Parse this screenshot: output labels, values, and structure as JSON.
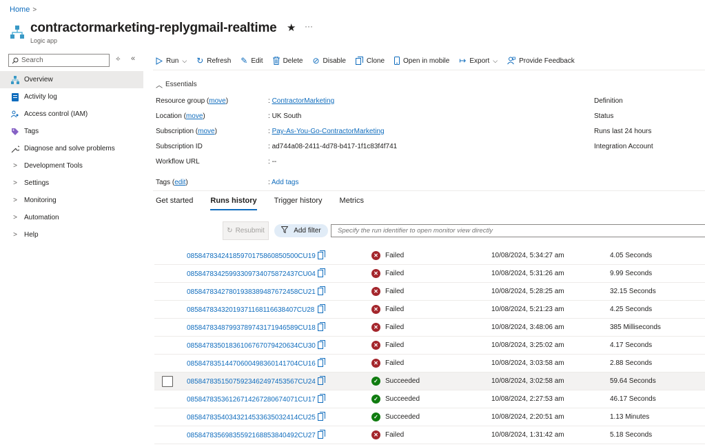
{
  "breadcrumb": {
    "home": "Home"
  },
  "header": {
    "title": "contractormarketing-replygmail-realtime",
    "subtitle": "Logic app",
    "star": "★",
    "more": "···"
  },
  "sidebar": {
    "search_placeholder": "Search",
    "items": [
      {
        "label": "Overview",
        "icon": "overview-icon"
      },
      {
        "label": "Activity log",
        "icon": "activity-log-icon"
      },
      {
        "label": "Access control (IAM)",
        "icon": "access-control-icon"
      },
      {
        "label": "Tags",
        "icon": "tag-icon"
      },
      {
        "label": "Diagnose and solve problems",
        "icon": "wrench-icon"
      },
      {
        "label": "Development Tools",
        "icon": "chevron-right-icon"
      },
      {
        "label": "Settings",
        "icon": "chevron-right-icon"
      },
      {
        "label": "Monitoring",
        "icon": "chevron-right-icon"
      },
      {
        "label": "Automation",
        "icon": "chevron-right-icon"
      },
      {
        "label": "Help",
        "icon": "chevron-right-icon"
      }
    ]
  },
  "toolbar": {
    "run": "Run",
    "refresh": "Refresh",
    "edit": "Edit",
    "delete": "Delete",
    "disable": "Disable",
    "clone": "Clone",
    "open_in_mobile": "Open in mobile",
    "export": "Export",
    "provide_feedback": "Provide Feedback"
  },
  "essentials": {
    "title": "Essentials",
    "move": "move",
    "edit": "edit",
    "resource_group_label": "Resource group",
    "resource_group_value": "ContractorMarketing",
    "location_label": "Location",
    "location_value": "UK South",
    "subscription_label": "Subscription",
    "subscription_value": "Pay-As-You-Go-ContractorMarketing",
    "subscription_id_label": "Subscription ID",
    "subscription_id_value": "ad744a08-2411-4d78-b417-1f1c83f4f741",
    "workflow_url_label": "Workflow URL",
    "workflow_url_value": "--",
    "tags_label": "Tags",
    "tags_value": "Add tags",
    "right_labels": [
      "Definition",
      "Status",
      "Runs last 24 hours",
      "Integration Account"
    ]
  },
  "tabs": [
    "Get started",
    "Runs history",
    "Trigger history",
    "Metrics"
  ],
  "active_tab": "Runs history",
  "filters": {
    "resubmit": "Resubmit",
    "add_filter": "Add filter",
    "run_id_placeholder": "Specify the run identifier to open monitor view directly"
  },
  "runs": [
    {
      "id": "08584783424185970175860850500CU19",
      "status": "Failed",
      "start": "10/08/2024, 5:34:27 am",
      "duration": "4.05 Seconds"
    },
    {
      "id": "08584783425993309734075872437CU04",
      "status": "Failed",
      "start": "10/08/2024, 5:31:26 am",
      "duration": "9.99 Seconds"
    },
    {
      "id": "08584783427801938389487672458CU21",
      "status": "Failed",
      "start": "10/08/2024, 5:28:25 am",
      "duration": "32.15 Seconds"
    },
    {
      "id": "08584783432019371168116638407CU28",
      "status": "Failed",
      "start": "10/08/2024, 5:21:23 am",
      "duration": "4.25 Seconds"
    },
    {
      "id": "08584783487993789743171946589CU18",
      "status": "Failed",
      "start": "10/08/2024, 3:48:06 am",
      "duration": "385 Milliseconds"
    },
    {
      "id": "08584783501836106767079420634CU30",
      "status": "Failed",
      "start": "10/08/2024, 3:25:02 am",
      "duration": "4.17 Seconds"
    },
    {
      "id": "08584783514470600498360141704CU16",
      "status": "Failed",
      "start": "10/08/2024, 3:03:58 am",
      "duration": "2.88 Seconds"
    },
    {
      "id": "08584783515075923462497453567CU24",
      "status": "Succeeded",
      "start": "10/08/2024, 3:02:58 am",
      "duration": "59.64 Seconds"
    },
    {
      "id": "08584783536126714267280674071CU17",
      "status": "Succeeded",
      "start": "10/08/2024, 2:27:53 am",
      "duration": "46.17 Seconds"
    },
    {
      "id": "08584783540343214533635032414CU25",
      "status": "Succeeded",
      "start": "10/08/2024, 2:20:51 am",
      "duration": "1.13 Minutes"
    },
    {
      "id": "08584783569835592168853840492CU27",
      "status": "Failed",
      "start": "10/08/2024, 1:31:42 am",
      "duration": "5.18 Seconds"
    }
  ],
  "colors": {
    "accent": "#0f6cbd",
    "failed": "#a4262c",
    "succeeded": "#107c10"
  }
}
